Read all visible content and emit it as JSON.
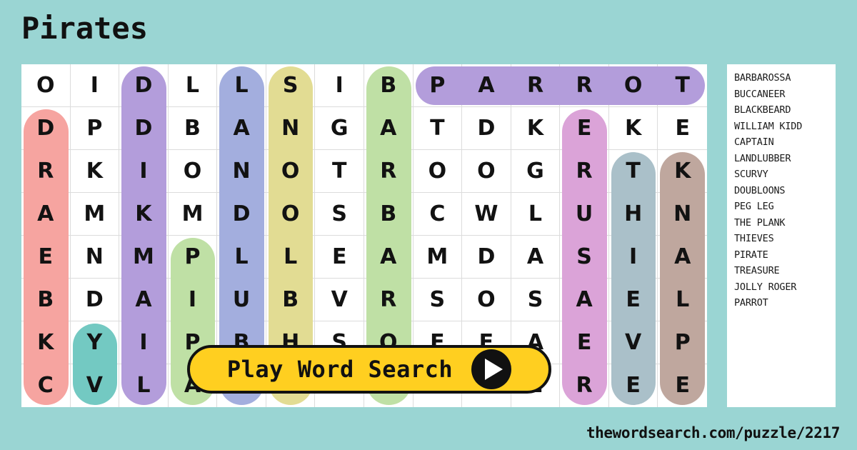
{
  "page": {
    "title": "Pirates",
    "background_color": "#9ad5d3",
    "footer_url": "thewordsearch.com/puzzle/2217"
  },
  "play_button": {
    "label": "Play Word Search",
    "icon": "play-triangle-icon",
    "background_color": "#ffcf20",
    "border_color": "#111111"
  },
  "grid": {
    "columns": 14,
    "rows": 8,
    "cell_border_color": "#dcdcdc",
    "letters": [
      [
        "O",
        "I",
        "D",
        "L",
        "L",
        "S",
        "I",
        "B",
        "P",
        "A",
        "R",
        "R",
        "O",
        "T"
      ],
      [
        "D",
        "P",
        "D",
        "B",
        "A",
        "N",
        "G",
        "A",
        "T",
        "D",
        "K",
        "E",
        "K",
        "E"
      ],
      [
        "R",
        "K",
        "I",
        "O",
        "N",
        "O",
        "T",
        "R",
        "O",
        "O",
        "G",
        "R",
        "T",
        "K"
      ],
      [
        "A",
        "M",
        "K",
        "M",
        "D",
        "O",
        "S",
        "B",
        "C",
        "W",
        "L",
        "U",
        "H",
        "N"
      ],
      [
        "E",
        "N",
        "M",
        "P",
        "L",
        "L",
        "E",
        "A",
        "M",
        "D",
        "A",
        "S",
        "I",
        "A"
      ],
      [
        "B",
        "D",
        "A",
        "I",
        "U",
        "B",
        "V",
        "R",
        "S",
        "O",
        "S",
        "A",
        "E",
        "L"
      ],
      [
        "K",
        "Y",
        "I",
        "P",
        "B",
        "H",
        "S",
        "O",
        "E",
        "E",
        "A",
        "E",
        "V",
        "P"
      ],
      [
        "C",
        "V",
        "L",
        "A",
        "G",
        "O",
        "R",
        "G",
        "Y",
        "L",
        "L",
        "R",
        "E",
        "E"
      ]
    ],
    "highlights": [
      {
        "word": "PARROT",
        "color": "#b39ddb",
        "orientation": "horizontal",
        "row": 0,
        "col_start": 8,
        "col_end": 13
      },
      {
        "word": "BLACKBEARD",
        "color": "#f6a4a0",
        "orientation": "vertical",
        "col": 0,
        "row_start": 1,
        "row_end": 7
      },
      {
        "word": "SCURVY",
        "color": "#73c9c2",
        "orientation": "vertical",
        "col": 1,
        "row_start": 6,
        "row_end": 7
      },
      {
        "word": "WILLIAM KIDD",
        "color": "#b39ddb",
        "orientation": "vertical",
        "col": 2,
        "row_start": 0,
        "row_end": 7
      },
      {
        "word": "PIRATE",
        "color": "#bfe0a5",
        "orientation": "vertical",
        "col": 3,
        "row_start": 4,
        "row_end": 7
      },
      {
        "word": "LANDLUBBER",
        "color": "#a3aede",
        "orientation": "vertical",
        "col": 4,
        "row_start": 0,
        "row_end": 7
      },
      {
        "word": "DOUBLOONS",
        "color": "#e2dc93",
        "orientation": "vertical",
        "col": 5,
        "row_start": 0,
        "row_end": 7
      },
      {
        "word": "BARBAROSSA",
        "color": "#bfe0a5",
        "orientation": "vertical",
        "col": 7,
        "row_start": 0,
        "row_end": 7
      },
      {
        "word": "TREASURE",
        "color": "#dba3d8",
        "orientation": "vertical",
        "col": 11,
        "row_start": 1,
        "row_end": 7
      },
      {
        "word": "THIEVES",
        "color": "#aac0c9",
        "orientation": "vertical",
        "col": 12,
        "row_start": 2,
        "row_end": 7
      },
      {
        "word": "THE PLANK",
        "color": "#bfa79e",
        "orientation": "vertical",
        "col": 13,
        "row_start": 2,
        "row_end": 7
      }
    ]
  },
  "word_list": [
    "BARBAROSSA",
    "BUCCANEER",
    "BLACKBEARD",
    "WILLIAM KIDD",
    "CAPTAIN",
    "LANDLUBBER",
    "SCURVY",
    "DOUBLOONS",
    "PEG LEG",
    "THE PLANK",
    "THIEVES",
    "PIRATE",
    "TREASURE",
    "JOLLY ROGER",
    "PARROT"
  ]
}
